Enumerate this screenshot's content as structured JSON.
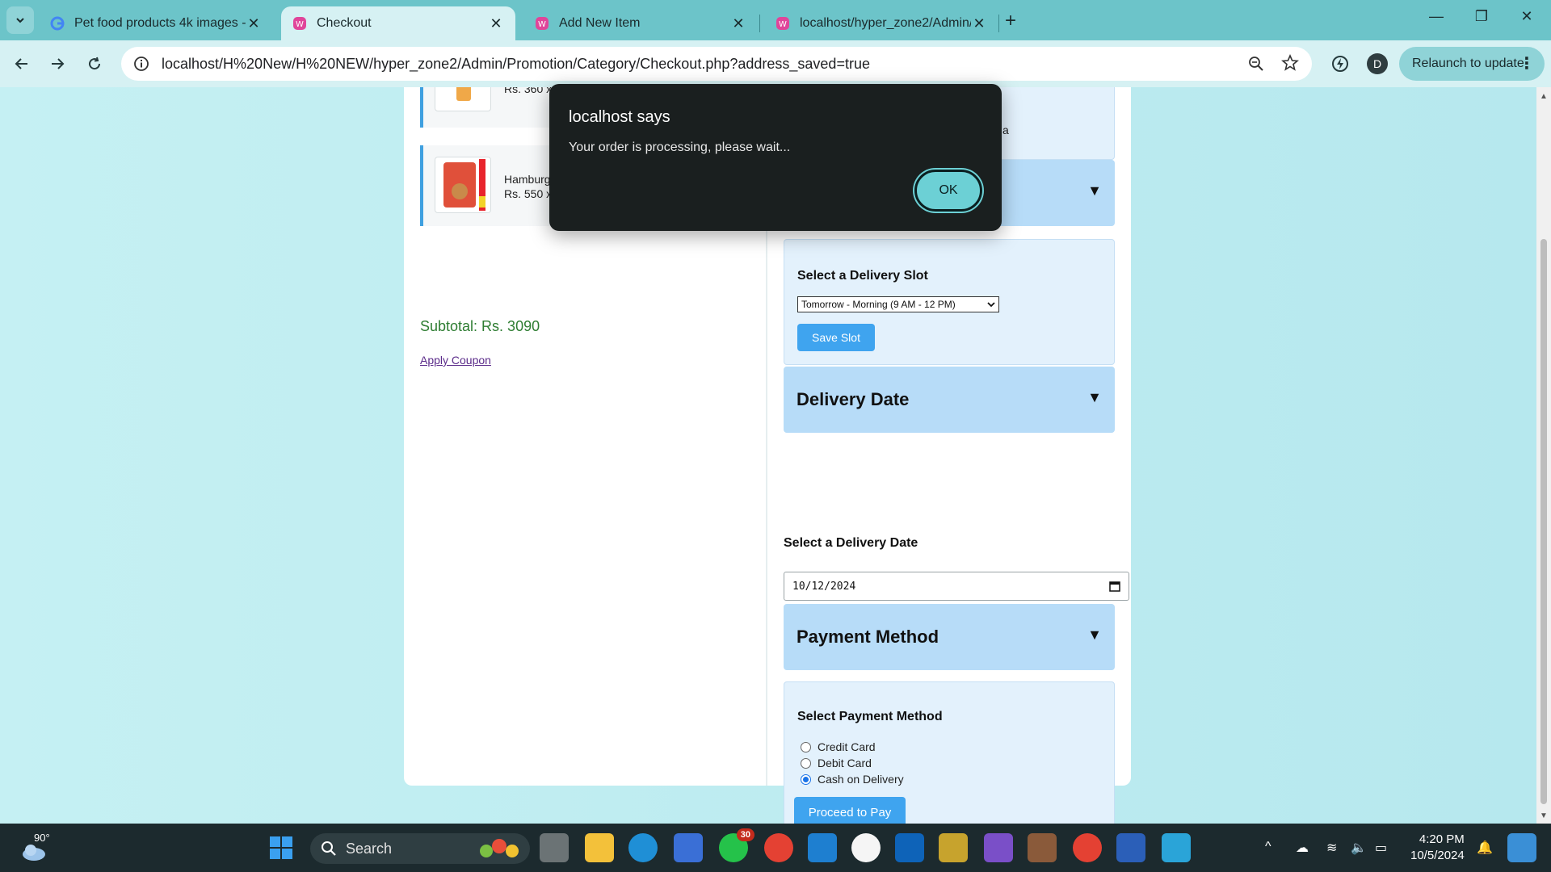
{
  "browser": {
    "tabs": [
      {
        "title": "Pet food products 4k images - (",
        "active": false
      },
      {
        "title": "Checkout",
        "active": true
      },
      {
        "title": "Add New Item",
        "active": false
      },
      {
        "title": "localhost/hyper_zone2/Admin/",
        "active": false
      }
    ],
    "url": "localhost/H%20New/H%20NEW/hyper_zone2/Admin/Promotion/Category/Checkout.php?address_saved=true",
    "profile_initial": "D",
    "relaunch_label": "Relaunch to update"
  },
  "cart": {
    "items": [
      {
        "name": "",
        "price": "Rs. 360 x"
      },
      {
        "name": "Hamburg",
        "price": "Rs. 550 x"
      }
    ],
    "subtotal": "Subtotal: Rs. 3090",
    "apply_coupon": "Apply Coupon"
  },
  "checkout": {
    "slot": {
      "title": "Select a Delivery Slot",
      "selected": "Tomorrow - Morning (9 AM - 12 PM)",
      "save_label": "Save Slot"
    },
    "delivery_date": {
      "header": "Delivery Date",
      "title": "Select a Delivery Date",
      "value": "10/12/2024"
    },
    "payment": {
      "header": "Payment Method",
      "title": "Select Payment Method",
      "options": [
        {
          "label": "Credit Card",
          "selected": false
        },
        {
          "label": "Debit Card",
          "selected": false
        },
        {
          "label": "Cash on Delivery",
          "selected": true
        }
      ],
      "proceed_label": "Proceed to Pay"
    },
    "hidden_text_fragment": "a"
  },
  "dialog": {
    "title": "localhost says",
    "message": "Your order is processing, please wait...",
    "ok_label": "OK"
  },
  "taskbar": {
    "weather": "90°",
    "search_placeholder": "Search",
    "whatsapp_badge": "30",
    "time": "4:20 PM",
    "date": "10/5/2024"
  },
  "colors": {
    "accent": "#3fa4ef",
    "section_header": "#b7dcf8",
    "panel": "#e3f1fc",
    "subtotal": "#2e7d32",
    "tabbar": "#6cc4c9",
    "dialog_bg": "#1a1f1f"
  }
}
